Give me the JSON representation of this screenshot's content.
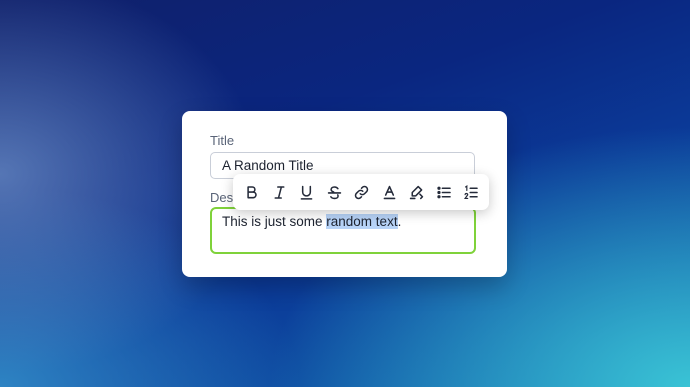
{
  "form": {
    "title_label": "Title",
    "title_value": "A Random Title",
    "description_label": "Description",
    "description_before": "This is just some ",
    "description_selected": "random text",
    "description_after": "."
  },
  "toolbar": {
    "buttons": [
      "bold-icon",
      "italic-icon",
      "underline-icon",
      "strikethrough-icon",
      "link-icon",
      "text-color-icon",
      "highlight-icon",
      "bullet-list-icon",
      "numbered-list-icon"
    ]
  },
  "colors": {
    "focus_border": "#7fd23a",
    "selection": "#b7d3f7"
  }
}
